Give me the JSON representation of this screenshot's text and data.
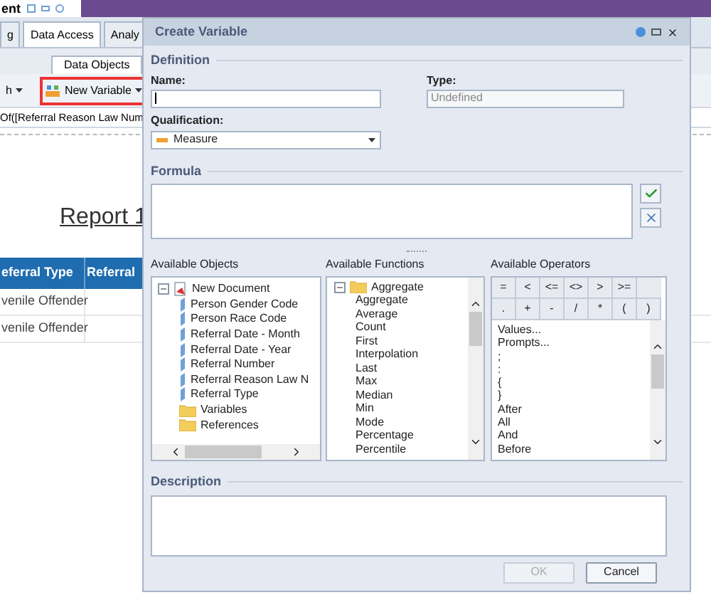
{
  "app": {
    "title": "ent",
    "tabs": [
      {
        "label": "g",
        "selected": false
      },
      {
        "label": "Data Access",
        "selected": true
      },
      {
        "label": "Analy",
        "selected": false
      }
    ],
    "subtab": {
      "label": "Data Objects"
    },
    "toolbar": [
      {
        "label": "h",
        "highlighted": false
      },
      {
        "label": "New Variable",
        "highlighted": true
      }
    ],
    "formula_bar": "Of([Referral Reason Law Num",
    "report_title": "Report 1",
    "table": {
      "columns": [
        "eferral Type",
        "Referral"
      ],
      "rows": [
        {
          "cells": [
            "venile Offender"
          ]
        },
        {
          "cells": [
            "venile Offender"
          ]
        }
      ]
    }
  },
  "dialog": {
    "title": "Create Variable",
    "definition": {
      "heading": "Definition",
      "name": {
        "label": "Name:"
      },
      "type": {
        "label": "Type:",
        "value": "Undefined",
        "disabled": true
      },
      "qualification": {
        "label": "Qualification:",
        "value": "Measure"
      }
    },
    "formula": {
      "heading": "Formula"
    },
    "objects": {
      "heading": "Available Objects",
      "tree": [
        {
          "label": "New Document",
          "kind": "document",
          "expanded": true,
          "children": [
            {
              "label": "Person Gender Code",
              "kind": "dimension"
            },
            {
              "label": "Person Race Code",
              "kind": "dimension"
            },
            {
              "label": "Referral Date - Month",
              "kind": "dimension"
            },
            {
              "label": "Referral Date - Year",
              "kind": "dimension"
            },
            {
              "label": "Referral Number",
              "kind": "dimension"
            },
            {
              "label": "Referral Reason Law N",
              "kind": "dimension"
            },
            {
              "label": "Referral Type",
              "kind": "dimension"
            },
            {
              "label": "Variables",
              "kind": "folder"
            },
            {
              "label": "References",
              "kind": "folder"
            }
          ]
        }
      ]
    },
    "functions": {
      "heading": "Available Functions",
      "tree": [
        {
          "label": "Aggregate",
          "kind": "folder",
          "expanded": true,
          "children": [
            {
              "label": "Aggregate"
            },
            {
              "label": "Average"
            },
            {
              "label": "Count"
            },
            {
              "label": "First"
            },
            {
              "label": "Interpolation"
            },
            {
              "label": "Last"
            },
            {
              "label": "Max"
            },
            {
              "label": "Median"
            },
            {
              "label": "Min"
            },
            {
              "label": "Mode"
            },
            {
              "label": "Percentage"
            },
            {
              "label": "Percentile"
            }
          ]
        }
      ]
    },
    "operators": {
      "heading": "Available Operators",
      "buttons": [
        [
          "=",
          "<",
          "<=",
          "<>",
          ">",
          ">="
        ],
        [
          ".",
          "+",
          "-",
          "/",
          "*",
          "(",
          ")"
        ]
      ],
      "list": [
        "Values...",
        "Prompts...",
        ";",
        ":",
        "{",
        "}",
        "After",
        "All",
        "And",
        "Before"
      ]
    },
    "description": {
      "heading": "Description"
    },
    "buttons": [
      {
        "label": "OK",
        "disabled": true
      },
      {
        "label": "Cancel",
        "disabled": false
      }
    ]
  }
}
